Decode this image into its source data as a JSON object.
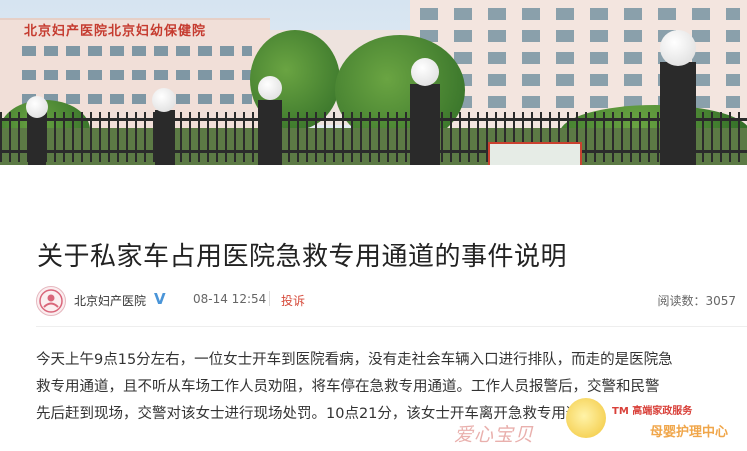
{
  "header_image": {
    "building_sign": "北京妇产医院北京妇幼保健院"
  },
  "article": {
    "title": "关于私家车占用医院急救专用通道的事件说明",
    "author": "北京妇产医院",
    "date": "08-14 12:54",
    "report_label": "投诉",
    "reads_label": "阅读数：3057",
    "paragraph_lines": [
      "今天上午9点15分左右，一位女士开车到医院看病，没有走社会车辆入口进行排队，而走的是医院急",
      "救专用通道，且不听从车场工作人员劝阻，将车停在急救专用通道。工作人员报警后，交警和民警",
      "先后赶到现场，交警对该女士进行现场处罚。10点21分，该女士开车离开急救专用通道。"
    ]
  },
  "watermark": {
    "left_text": "爱心宝贝",
    "brand_top": "TM 高端家政服务",
    "right_text": "母婴护理中心"
  },
  "colors": {
    "title": "#222222",
    "report": "#d64a3a",
    "verified": "#4a95d8"
  }
}
